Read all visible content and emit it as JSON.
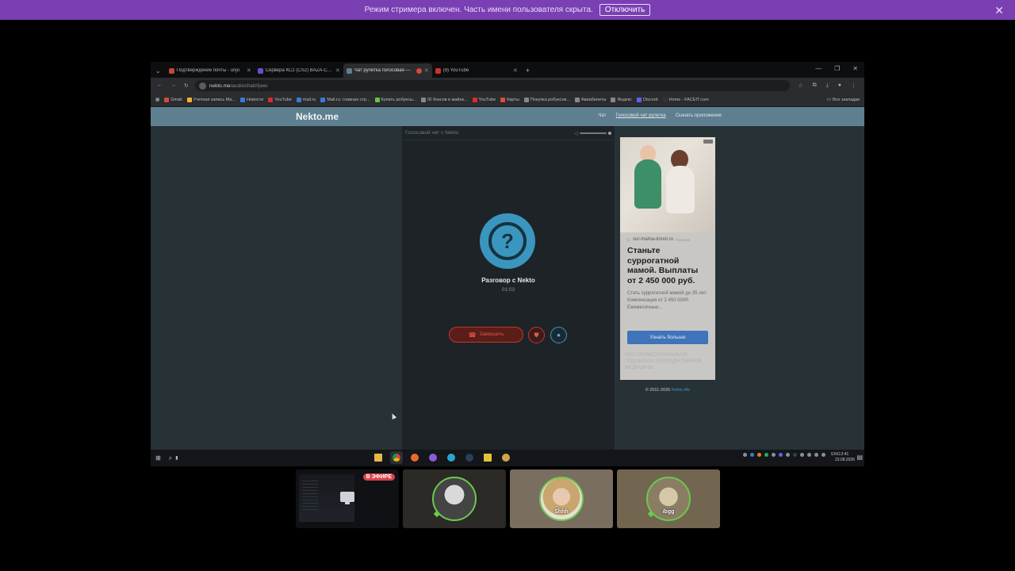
{
  "banner": {
    "text": "Режим стримера включен. Часть имени пользователя скрыта.",
    "button": "Отключить",
    "close": "✕"
  },
  "browser": {
    "tabs": [
      {
        "title": "Подтверждение почты - unjo",
        "color": "#c5463a"
      },
      {
        "title": "Сервера КС2 (CS2) BAZA-CS2",
        "color": "#6b4fc9"
      },
      {
        "title": "Чат рулетка голосовая — ",
        "color": "#5e7f8f"
      },
      {
        "title": "(9) YouTube",
        "color": "#d32f2f"
      }
    ],
    "url": "nekto.me",
    "url_path": "/audiochat#/jwei",
    "bookmarks": [
      {
        "label": "Gmail",
        "color": "#d24b3e"
      },
      {
        "label": "Учетная запись Ma...",
        "color": "#f2b233"
      },
      {
        "label": "Новости",
        "color": "#3b7bd5"
      },
      {
        "label": "YouTube",
        "color": "#d32f2f"
      },
      {
        "label": "mail.ru",
        "color": "#3b7bd5"
      },
      {
        "label": "Mail.ru: главная стр...",
        "color": "#3b7bd5"
      },
      {
        "label": "Купить робуксы...",
        "color": "#6bbf45"
      },
      {
        "label": "ID боксов в майнк...",
        "color": "#888888"
      },
      {
        "label": "YouTube",
        "color": "#d32f2f"
      },
      {
        "label": "Карты",
        "color": "#e04b3a"
      },
      {
        "label": "Покупка робуксов...",
        "color": "#888888"
      },
      {
        "label": "Авиабилеты",
        "color": "#888888"
      },
      {
        "label": "Яндекс",
        "color": "#888888"
      },
      {
        "label": "Discord",
        "color": "#5865f2"
      },
      {
        "label": "Home - FACEIT.com",
        "color": "#333333"
      }
    ],
    "all_bookmarks": "Все закладки"
  },
  "site": {
    "logo": "Nekto.me",
    "menu": [
      "Чат",
      "Голосовой чат рулетка",
      "Скачать приложение"
    ],
    "chat_header": "Голосовой чат с Nekto",
    "call_name": "Разговор с Nekto",
    "call_time": "01:03",
    "end_button": "Завершить",
    "avatar_symbol": "?"
  },
  "ad": {
    "domain": "sur-mama-donor.ru",
    "sponsor": "Реклама",
    "headline": "Станьте суррогатной мамой. Выплаты от 2 450 000 руб.",
    "description": "Стать суррогатной мамой до 35 лет. Компенсация от 2 450 000Р. Ежемесячные...",
    "cta": "Узнать больше",
    "ghost_text": "ПОЗ ПРОФЕССИОНАЛЬНО ПОДОБРАЛИ РЕПРОДУКТИВНОЙ МЕДИЦИНЫ"
  },
  "footer": {
    "copyright": "© 2011-2026 ",
    "copyright_link": "Nekto.Me"
  },
  "taskbar": {
    "lang": "ENG",
    "time": "2:41",
    "date": "23.08.2026"
  },
  "participants": [
    {
      "name": "",
      "live": "В ЭФИРЕ"
    },
    {
      "name": ""
    },
    {
      "name": "Shhh"
    },
    {
      "name": "ibgg"
    }
  ]
}
